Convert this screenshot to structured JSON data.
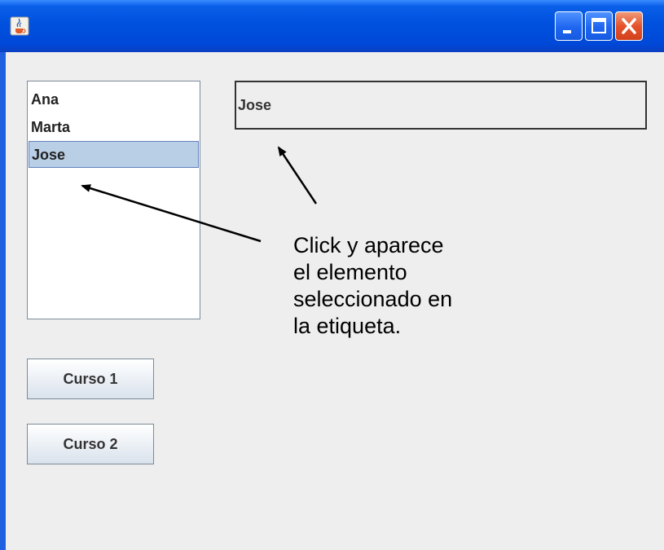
{
  "window": {
    "icon": "java-cup-icon",
    "controls": {
      "minimize": "minimize-icon",
      "maximize": "maximize-icon",
      "close": "close-icon"
    }
  },
  "list": {
    "items": [
      "Ana",
      "Marta",
      "Jose"
    ],
    "selected_index": 2
  },
  "label": {
    "text": "Jose"
  },
  "buttons": {
    "curso1": "Curso 1",
    "curso2": "Curso 2"
  },
  "annotation": {
    "lines": [
      "Click y aparece",
      "el elemento",
      "seleccionado en",
      "la etiqueta."
    ]
  },
  "colors": {
    "titlebar": "#0051de",
    "selection": "#b8cfe5",
    "panel": "#eeeeee",
    "close_button": "#e4532c"
  }
}
